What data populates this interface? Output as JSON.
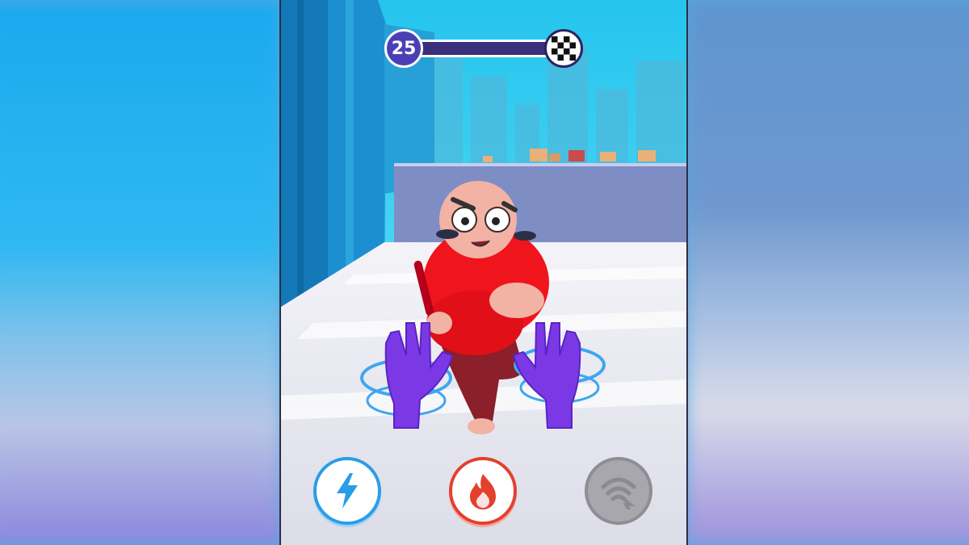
{
  "hud": {
    "level_number": "25",
    "level_progress": 0.05,
    "finish_icon": "checkered-flag-icon"
  },
  "abilities": [
    {
      "name": "lightning",
      "icon": "lightning-bolt-icon",
      "state": "available",
      "color": "#2a9de8"
    },
    {
      "name": "fire",
      "icon": "flame-icon",
      "state": "available",
      "color": "#e3402e"
    },
    {
      "name": "grab",
      "icon": "wifi-hand-icon",
      "state": "locked",
      "color": "#8d8d93"
    }
  ],
  "scene": {
    "enemy": "bald-man-with-red-bat",
    "player_hands": "purple-gloves-with-energy-rings",
    "sky_color": "#2fd0ee",
    "floor_color": "#e9eaf3"
  }
}
